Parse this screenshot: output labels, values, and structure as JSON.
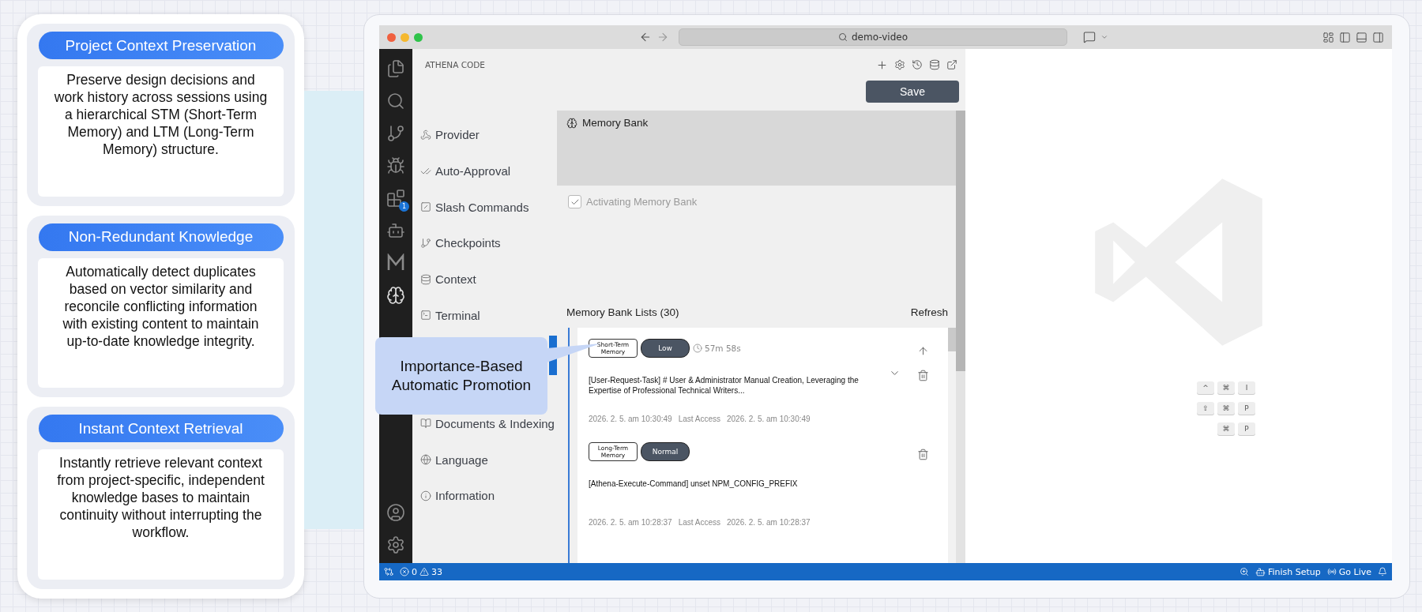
{
  "features": [
    {
      "title": "Project Context Preservation",
      "description": "Preserve design decisions and work history across sessions using a hierarchical STM (Short-Term Memory) and LTM (Long-Term Memory) structure."
    },
    {
      "title": "Non-Redundant Knowledge",
      "description": "Automatically detect duplicates based on vector similarity and reconcile conflicting information with existing content to maintain up-to-date knowledge integrity."
    },
    {
      "title": "Instant Context Retrieval",
      "description": "Instantly retrieve relevant context from project-specific, independent knowledge bases to maintain continuity without interrupting the workflow."
    }
  ],
  "browser": {
    "search": "demo-video"
  },
  "activity_bar": {
    "badge": "1"
  },
  "sidebar": {
    "title": "ATHENA CODE",
    "save_button": "Save",
    "nav_items": [
      {
        "kind": "provider",
        "label": "Provider"
      },
      {
        "kind": "approval",
        "label": "Auto-Approval"
      },
      {
        "kind": "slash",
        "label": "Slash Commands"
      },
      {
        "kind": "checkpoints",
        "label": "Checkpoints"
      },
      {
        "kind": "context",
        "label": "Context"
      },
      {
        "kind": "terminal",
        "label": "Terminal"
      },
      {
        "kind": "hidden"
      },
      {
        "kind": "hidden"
      },
      {
        "kind": "documents",
        "label": "Documents & Indexing"
      },
      {
        "kind": "language",
        "label": "Language"
      },
      {
        "kind": "information",
        "label": "Information"
      }
    ]
  },
  "memory_bank": {
    "title": "Memory Bank",
    "activate": {
      "label": "Activating Memory Bank",
      "checked": true
    },
    "list_title": "Memory Bank Lists (30)",
    "refresh": "Refresh",
    "entries": [
      {
        "type": "Short-Term Memory",
        "importance": "Low",
        "age": "57m 58s",
        "text": "[User-Request-Task] # User & Administrator Manual Creation, Leveraging the Expertise of Professional Technical Writers...",
        "created": "2026. 2. 5. am 10:30:49",
        "last_access_label": "Last Access",
        "last_access": "2026. 2. 5. am 10:30:49",
        "promotable": true,
        "expandable": true
      },
      {
        "type": "Long-Term Memory",
        "importance": "Normal",
        "text": "[Athena-Execute-Command] unset NPM_CONFIG_PREFIX",
        "created": "2026. 2. 5. am 10:28:37",
        "last_access_label": "Last Access",
        "last_access": "2026. 2. 5. am 10:28:37",
        "promotable": false,
        "expandable": false
      }
    ]
  },
  "callout": "Importance-Based Automatic Promotion",
  "shortcuts": [
    [
      "^",
      "⌘",
      "I"
    ],
    [
      "⇧",
      "⌘",
      "P"
    ],
    [
      "⌘",
      "P"
    ]
  ],
  "status_bar": {
    "errors": "0",
    "warnings": "33",
    "finish_setup": "Finish Setup",
    "go_live": "Go Live"
  }
}
